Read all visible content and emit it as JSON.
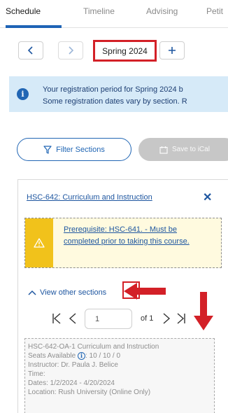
{
  "tabs": [
    {
      "label": "Schedule",
      "active": true
    },
    {
      "label": "Timeline",
      "active": false
    },
    {
      "label": "Advising",
      "active": false
    },
    {
      "label": "Petit",
      "active": false
    }
  ],
  "term": {
    "label": "Spring 2024",
    "prev_icon": "chevron-left-icon",
    "next_icon": "chevron-right-icon",
    "add_icon": "plus-icon"
  },
  "banner": {
    "icon": "info-icon",
    "line1": "Your registration period for Spring 2024 b",
    "line2": "Some registration dates vary by section. R"
  },
  "actions": {
    "filter_label": "Filter Sections",
    "filter_icon": "filter-icon",
    "ical_label": "Save to iCal",
    "ical_icon": "calendar-icon"
  },
  "course": {
    "title": "HSC-642: Curriculum and Instruction",
    "prerequisite": "Prerequisite: HSC-641. - Must be completed prior to taking this course.",
    "prerequisite_icon": "warning-icon",
    "view_other_sections": "View other sections",
    "pager": {
      "current": "1",
      "of": "of 1"
    },
    "section": {
      "title": "HSC-642-OA-1 Curriculum and Instruction",
      "seats_label": "Seats Available",
      "seats_value": ": 10 / 10 / 0",
      "instructor": "Instructor: Dr. Paula J. Belice",
      "time": "Time:",
      "dates": "Dates: 1/2/2024 - 4/20/2024",
      "location": "Location: Rush University (Online Only)"
    }
  },
  "colors": {
    "accent": "#2166b4",
    "link": "#1e56a0",
    "annotation": "#d32027",
    "warning": "#f1c21b"
  }
}
